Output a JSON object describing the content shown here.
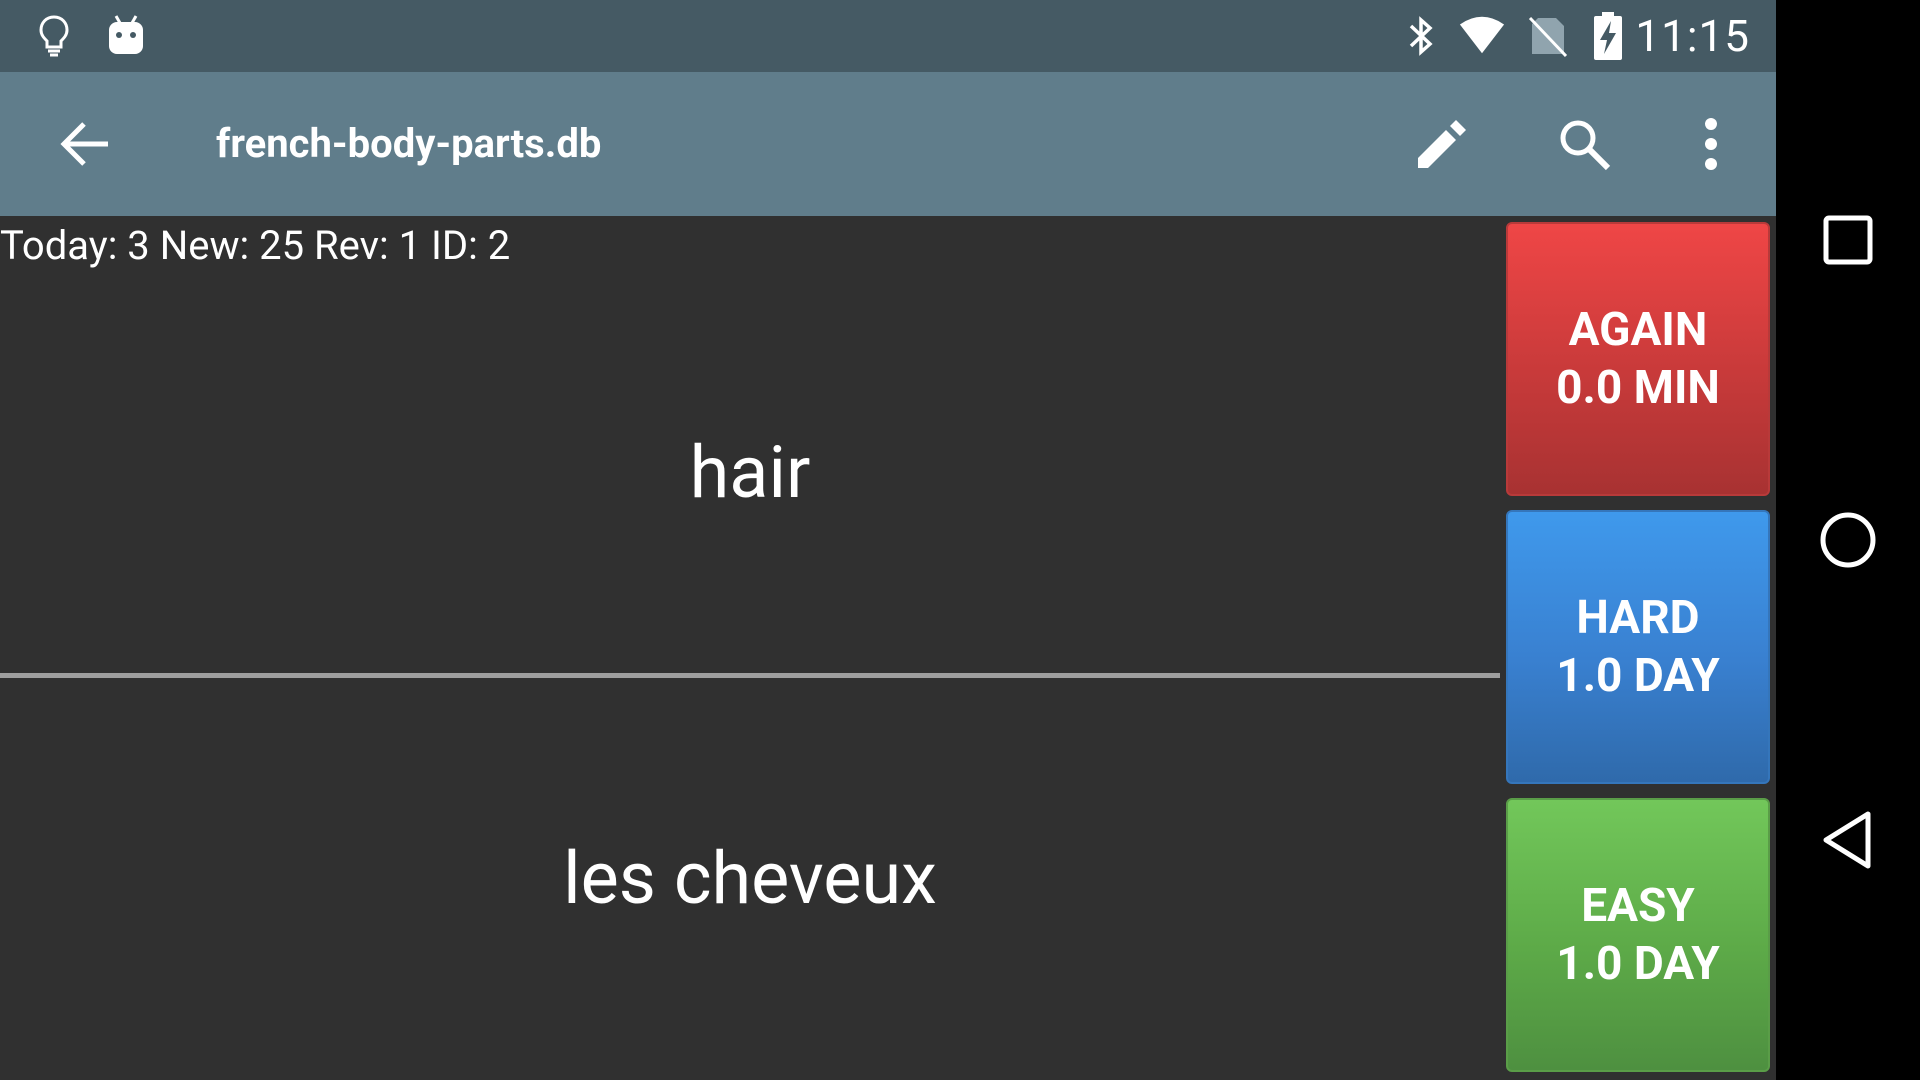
{
  "status_bar": {
    "time": "11:15",
    "left_icons": [
      "lightbulb-icon",
      "android-debug-icon"
    ],
    "right_icons": [
      "bluetooth-icon",
      "wifi-icon",
      "no-sim-icon",
      "battery-charging-icon"
    ]
  },
  "toolbar": {
    "title": "french-body-parts.db",
    "icons": [
      "back-arrow-icon",
      "pencil-icon",
      "search-icon",
      "more-vert-icon"
    ]
  },
  "counts": {
    "text": "Today: 3 New: 25 Rev: 1 ID: 2"
  },
  "card": {
    "front": "hair",
    "back": "les cheveux"
  },
  "answers": {
    "again": {
      "label": "AGAIN",
      "interval": "0.0 MIN",
      "color": "#d63d3d"
    },
    "hard": {
      "label": "HARD",
      "interval": "1.0 DAY",
      "color": "#3a86d8"
    },
    "easy": {
      "label": "EASY",
      "interval": "1.0 DAY",
      "color": "#62b24c"
    }
  },
  "nav_bar": {
    "icons": [
      "recents-icon",
      "home-icon",
      "back-icon"
    ]
  },
  "colors": {
    "status_bar": "#455a64",
    "toolbar": "#607d8b",
    "background": "#303030",
    "divider": "#9e9e9e"
  }
}
